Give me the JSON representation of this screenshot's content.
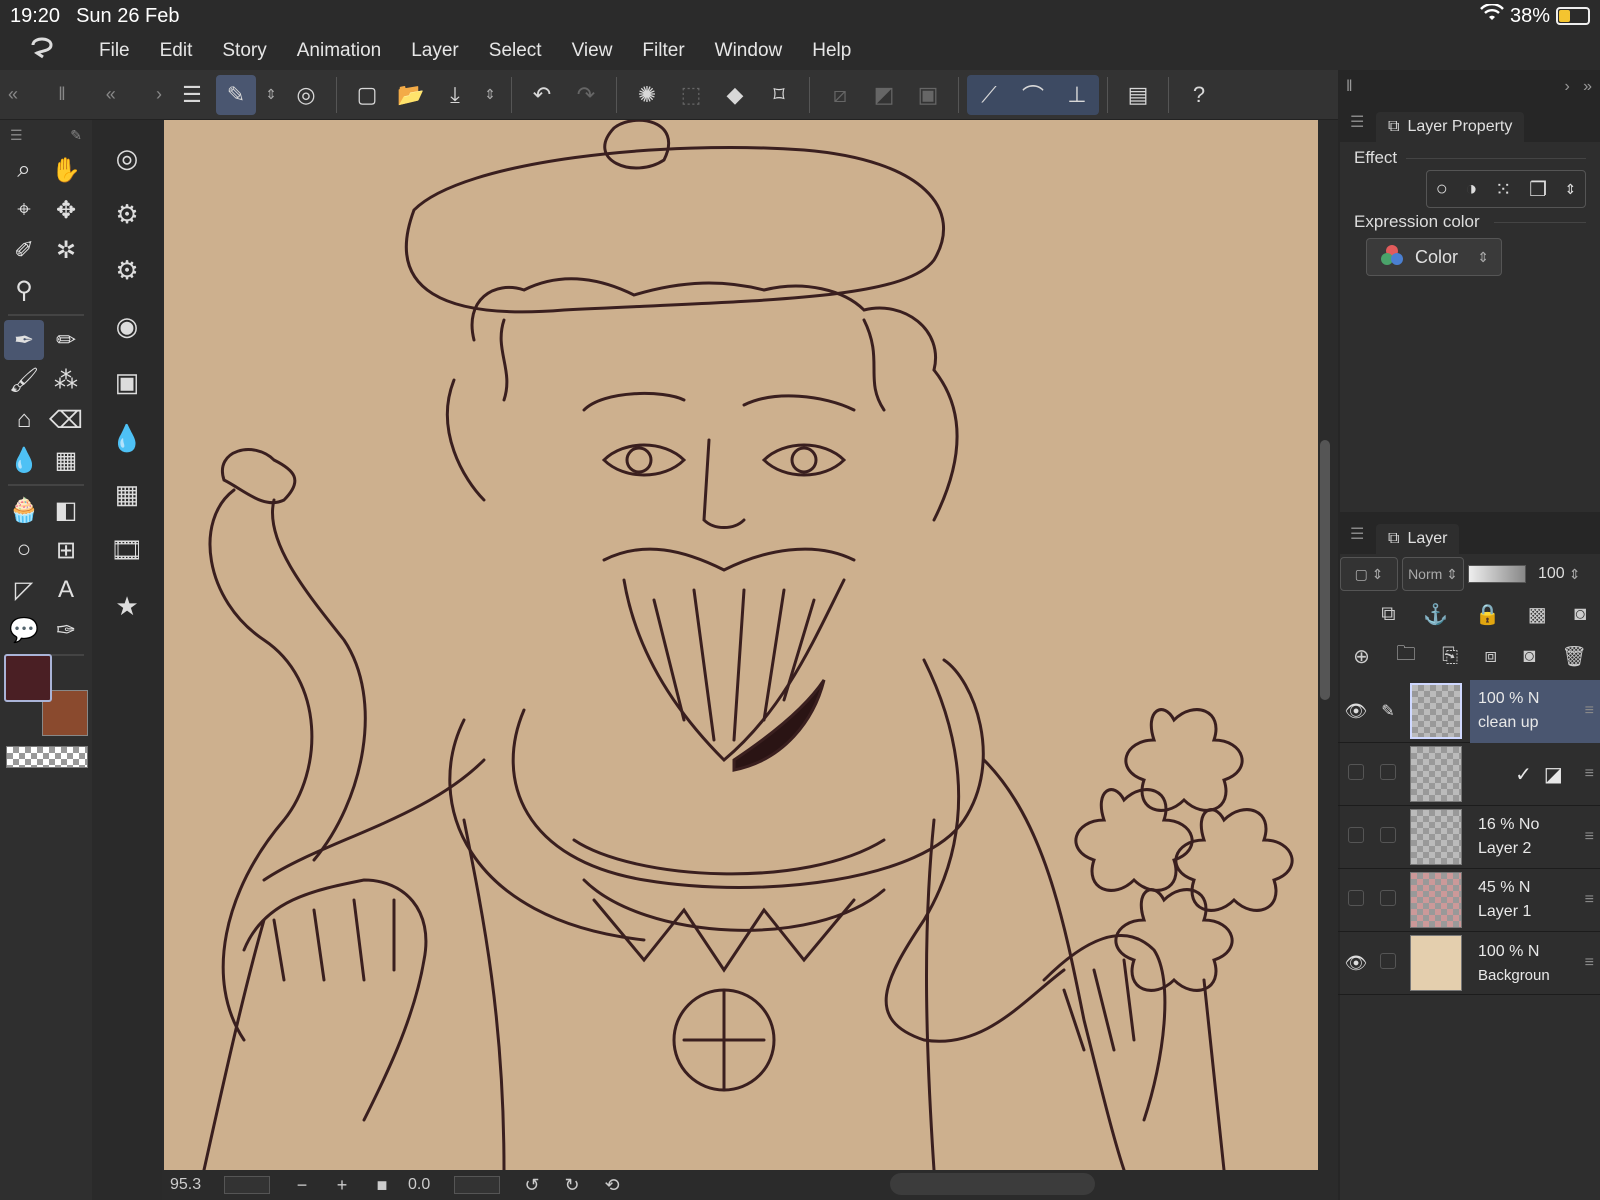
{
  "status": {
    "time": "19:20",
    "date": "Sun 26 Feb",
    "battery": "38%",
    "battery_level": 0.38
  },
  "menu": {
    "items": [
      "File",
      "Edit",
      "Story",
      "Animation",
      "Layer",
      "Select",
      "View",
      "Filter",
      "Window",
      "Help"
    ]
  },
  "colors": {
    "canvas_bg": "#cdb08e",
    "main_color": "#4a1f24",
    "sub_color": "#8a4a2e",
    "accent": "#4a5670"
  },
  "panel": {
    "property_title": "Layer Property",
    "effect_label": "Effect",
    "expression_label": "Expression color",
    "expression_value": "Color",
    "layer_title": "Layer",
    "blend_mode": "Norm",
    "opacity": "100"
  },
  "layers": [
    {
      "pct": "100 % N",
      "name": "clean up",
      "visible": true,
      "selected": true
    },
    {
      "pct": "",
      "name": "",
      "visible": false,
      "selected": false
    },
    {
      "pct": "16 % No",
      "name": "Layer 2",
      "visible": false,
      "selected": false
    },
    {
      "pct": "45 % N",
      "name": "Layer 1",
      "visible": false,
      "selected": false
    },
    {
      "pct": "100 % N",
      "name": "Backgroun",
      "visible": true,
      "selected": false
    }
  ],
  "bottom": {
    "zoom": "95.3",
    "rotation": "0.0"
  }
}
